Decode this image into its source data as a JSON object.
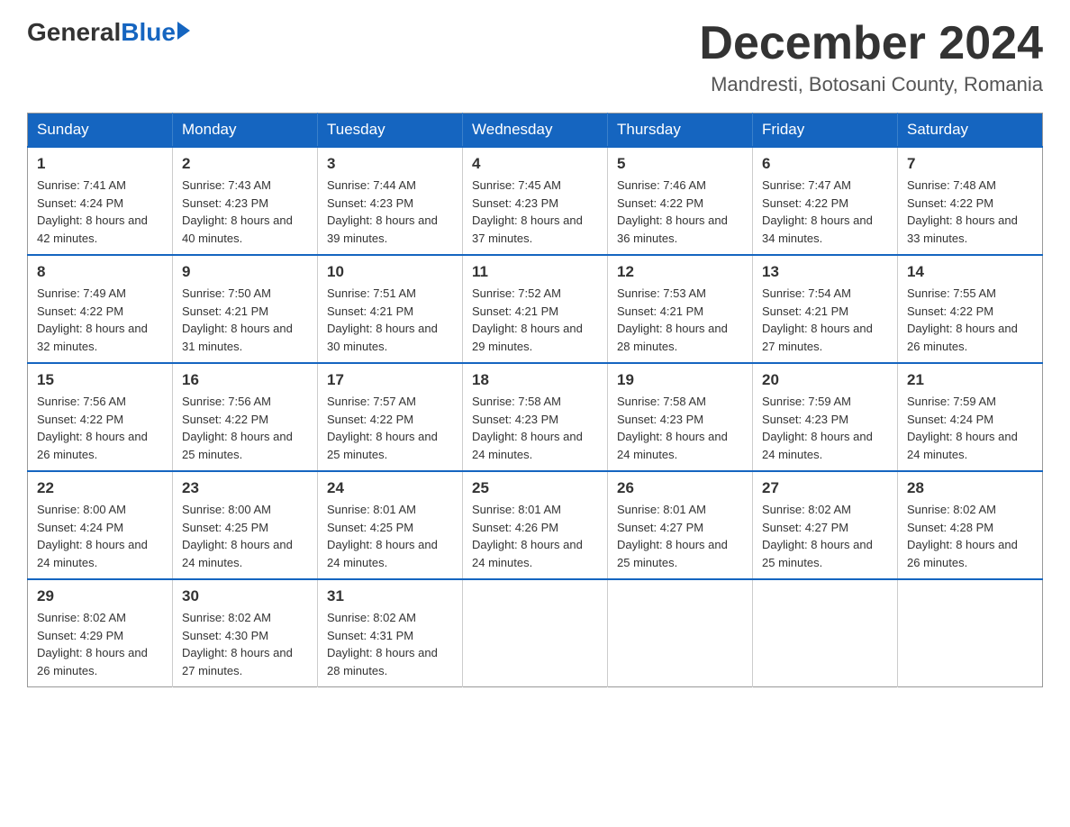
{
  "logo": {
    "general": "General",
    "blue": "Blue"
  },
  "title": {
    "month": "December 2024",
    "location": "Mandresti, Botosani County, Romania"
  },
  "weekdays": [
    "Sunday",
    "Monday",
    "Tuesday",
    "Wednesday",
    "Thursday",
    "Friday",
    "Saturday"
  ],
  "weeks": [
    [
      {
        "day": "1",
        "sunrise": "7:41 AM",
        "sunset": "4:24 PM",
        "daylight": "8 hours and 42 minutes."
      },
      {
        "day": "2",
        "sunrise": "7:43 AM",
        "sunset": "4:23 PM",
        "daylight": "8 hours and 40 minutes."
      },
      {
        "day": "3",
        "sunrise": "7:44 AM",
        "sunset": "4:23 PM",
        "daylight": "8 hours and 39 minutes."
      },
      {
        "day": "4",
        "sunrise": "7:45 AM",
        "sunset": "4:23 PM",
        "daylight": "8 hours and 37 minutes."
      },
      {
        "day": "5",
        "sunrise": "7:46 AM",
        "sunset": "4:22 PM",
        "daylight": "8 hours and 36 minutes."
      },
      {
        "day": "6",
        "sunrise": "7:47 AM",
        "sunset": "4:22 PM",
        "daylight": "8 hours and 34 minutes."
      },
      {
        "day": "7",
        "sunrise": "7:48 AM",
        "sunset": "4:22 PM",
        "daylight": "8 hours and 33 minutes."
      }
    ],
    [
      {
        "day": "8",
        "sunrise": "7:49 AM",
        "sunset": "4:22 PM",
        "daylight": "8 hours and 32 minutes."
      },
      {
        "day": "9",
        "sunrise": "7:50 AM",
        "sunset": "4:21 PM",
        "daylight": "8 hours and 31 minutes."
      },
      {
        "day": "10",
        "sunrise": "7:51 AM",
        "sunset": "4:21 PM",
        "daylight": "8 hours and 30 minutes."
      },
      {
        "day": "11",
        "sunrise": "7:52 AM",
        "sunset": "4:21 PM",
        "daylight": "8 hours and 29 minutes."
      },
      {
        "day": "12",
        "sunrise": "7:53 AM",
        "sunset": "4:21 PM",
        "daylight": "8 hours and 28 minutes."
      },
      {
        "day": "13",
        "sunrise": "7:54 AM",
        "sunset": "4:21 PM",
        "daylight": "8 hours and 27 minutes."
      },
      {
        "day": "14",
        "sunrise": "7:55 AM",
        "sunset": "4:22 PM",
        "daylight": "8 hours and 26 minutes."
      }
    ],
    [
      {
        "day": "15",
        "sunrise": "7:56 AM",
        "sunset": "4:22 PM",
        "daylight": "8 hours and 26 minutes."
      },
      {
        "day": "16",
        "sunrise": "7:56 AM",
        "sunset": "4:22 PM",
        "daylight": "8 hours and 25 minutes."
      },
      {
        "day": "17",
        "sunrise": "7:57 AM",
        "sunset": "4:22 PM",
        "daylight": "8 hours and 25 minutes."
      },
      {
        "day": "18",
        "sunrise": "7:58 AM",
        "sunset": "4:23 PM",
        "daylight": "8 hours and 24 minutes."
      },
      {
        "day": "19",
        "sunrise": "7:58 AM",
        "sunset": "4:23 PM",
        "daylight": "8 hours and 24 minutes."
      },
      {
        "day": "20",
        "sunrise": "7:59 AM",
        "sunset": "4:23 PM",
        "daylight": "8 hours and 24 minutes."
      },
      {
        "day": "21",
        "sunrise": "7:59 AM",
        "sunset": "4:24 PM",
        "daylight": "8 hours and 24 minutes."
      }
    ],
    [
      {
        "day": "22",
        "sunrise": "8:00 AM",
        "sunset": "4:24 PM",
        "daylight": "8 hours and 24 minutes."
      },
      {
        "day": "23",
        "sunrise": "8:00 AM",
        "sunset": "4:25 PM",
        "daylight": "8 hours and 24 minutes."
      },
      {
        "day": "24",
        "sunrise": "8:01 AM",
        "sunset": "4:25 PM",
        "daylight": "8 hours and 24 minutes."
      },
      {
        "day": "25",
        "sunrise": "8:01 AM",
        "sunset": "4:26 PM",
        "daylight": "8 hours and 24 minutes."
      },
      {
        "day": "26",
        "sunrise": "8:01 AM",
        "sunset": "4:27 PM",
        "daylight": "8 hours and 25 minutes."
      },
      {
        "day": "27",
        "sunrise": "8:02 AM",
        "sunset": "4:27 PM",
        "daylight": "8 hours and 25 minutes."
      },
      {
        "day": "28",
        "sunrise": "8:02 AM",
        "sunset": "4:28 PM",
        "daylight": "8 hours and 26 minutes."
      }
    ],
    [
      {
        "day": "29",
        "sunrise": "8:02 AM",
        "sunset": "4:29 PM",
        "daylight": "8 hours and 26 minutes."
      },
      {
        "day": "30",
        "sunrise": "8:02 AM",
        "sunset": "4:30 PM",
        "daylight": "8 hours and 27 minutes."
      },
      {
        "day": "31",
        "sunrise": "8:02 AM",
        "sunset": "4:31 PM",
        "daylight": "8 hours and 28 minutes."
      },
      null,
      null,
      null,
      null
    ]
  ],
  "labels": {
    "sunrise": "Sunrise:",
    "sunset": "Sunset:",
    "daylight": "Daylight:"
  }
}
